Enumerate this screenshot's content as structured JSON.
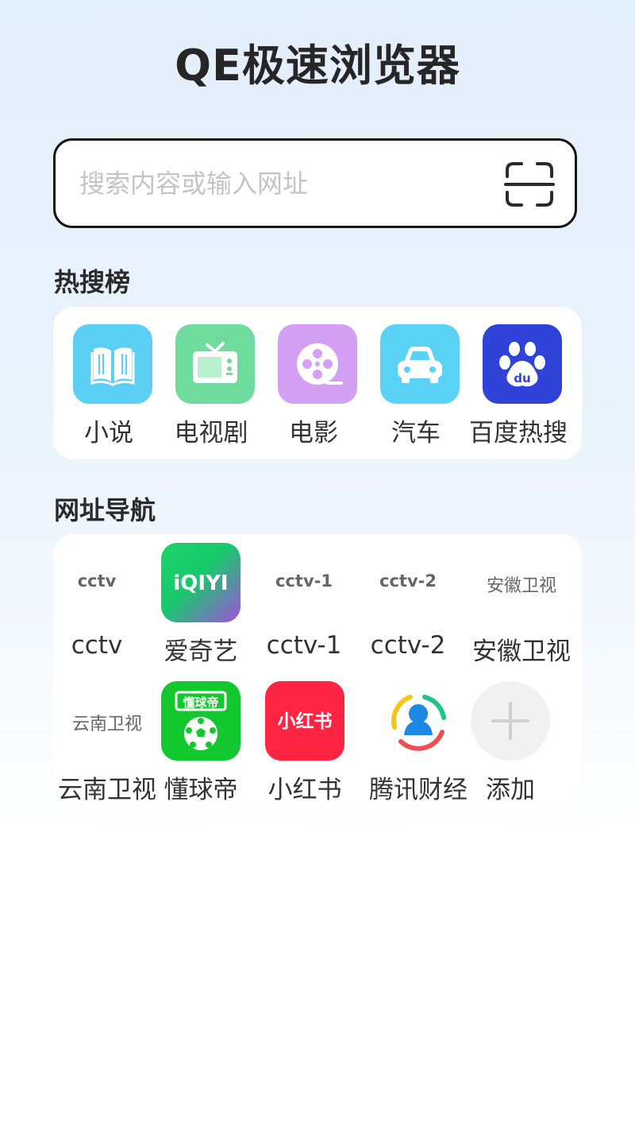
{
  "app": {
    "title": "QE极速浏览器"
  },
  "search": {
    "placeholder": "搜索内容或输入网址",
    "value": ""
  },
  "hot_section": {
    "title": "热搜榜",
    "items": [
      {
        "label": "小说",
        "icon": "book-icon",
        "color": "#5cd0f4"
      },
      {
        "label": "电视剧",
        "icon": "tv-icon",
        "color": "#6fdc9d"
      },
      {
        "label": "电影",
        "icon": "film-reel-icon",
        "color": "#d4a0f3"
      },
      {
        "label": "汽车",
        "icon": "car-icon",
        "color": "#5ad2f5"
      },
      {
        "label": "百度热搜",
        "icon": "baidu-paw-icon",
        "color": "#2f43d8"
      }
    ]
  },
  "nav_section": {
    "title": "网址导航",
    "items": [
      {
        "label": "cctv",
        "logo_text": "cctv"
      },
      {
        "label": "爱奇艺",
        "logo_text": "iQIYI",
        "icon": "iqiyi-logo-icon"
      },
      {
        "label": "cctv-1",
        "logo_text": "cctv-1"
      },
      {
        "label": "cctv-2",
        "logo_text": "cctv-2"
      },
      {
        "label": "安徽卫视",
        "logo_text": "安徽卫视"
      },
      {
        "label": "云南卫视",
        "logo_text": "云南卫视"
      },
      {
        "label": "懂球帝",
        "logo_text": "懂球帝",
        "icon": "dongqiudi-logo-icon"
      },
      {
        "label": "小红书",
        "logo_text": "小红书",
        "icon": "xiaohongshu-logo-icon"
      },
      {
        "label": "腾讯财经",
        "icon": "tencent-finance-logo-icon"
      },
      {
        "label": "添加",
        "icon": "plus-icon"
      }
    ]
  },
  "colors": {
    "iqiyi_start": "#1fd26a",
    "iqiyi_end": "#a34ee0",
    "dongqiudi": "#13c82e",
    "xiaohongshu": "#ff2442",
    "baidu": "#2f43d8"
  }
}
